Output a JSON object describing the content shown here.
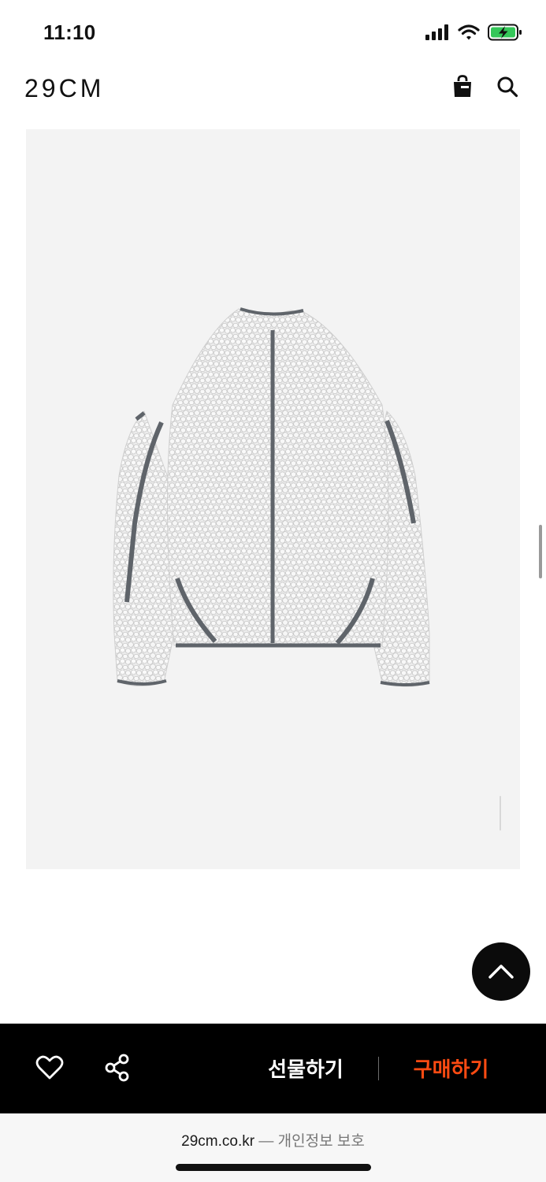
{
  "status_bar": {
    "time": "11:10",
    "signal_icon": "cellular-signal-icon",
    "wifi_icon": "wifi-icon",
    "battery_icon": "battery-charging-icon",
    "battery_color": "#34c759"
  },
  "header": {
    "logo": "29CM",
    "cart_icon": "shopping-bag-icon",
    "search_icon": "search-icon"
  },
  "product": {
    "image_icon": "fleece-jacket-image",
    "background": "#f3f3f3"
  },
  "floating": {
    "top_icon": "chevron-up-icon"
  },
  "action_bar": {
    "like_icon": "heart-icon",
    "share_icon": "share-icon",
    "gift_label": "선물하기",
    "buy_label": "구매하기",
    "buy_color": "#ff4b12"
  },
  "browser": {
    "domain": "29cm.co.kr",
    "separator": "—",
    "privacy_label": "개인정보 보호"
  }
}
